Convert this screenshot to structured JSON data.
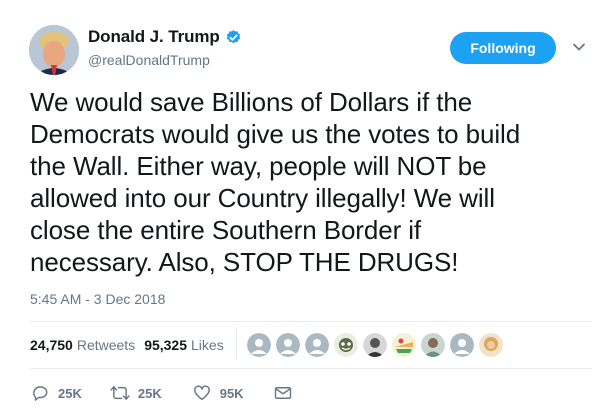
{
  "author": {
    "display_name": "Donald J. Trump",
    "handle": "@realDonaldTrump",
    "verified": true
  },
  "follow_button": {
    "label": "Following"
  },
  "tweet": {
    "lines": [
      "We would save Billions of Dollars if the",
      "Democrats would give us the votes to build",
      "the Wall. Either way, people will NOT be",
      "allowed into our Country illegally! We will",
      "close the entire Southern Border if",
      "necessary. Also, STOP THE DRUGS!"
    ],
    "timestamp": "5:45 AM - 3 Dec 2018"
  },
  "stats": {
    "retweets": {
      "count": "24,750",
      "label": "Retweets"
    },
    "likes": {
      "count": "95,325",
      "label": "Likes"
    }
  },
  "likers": [
    {
      "icon": "default-avatar",
      "color": "#aab8c2"
    },
    {
      "icon": "default-avatar",
      "color": "#aab8c2"
    },
    {
      "icon": "default-avatar",
      "color": "#aab8c2"
    },
    {
      "icon": "cartoon-avatar",
      "color": "#5d6b4a"
    },
    {
      "icon": "photo-avatar",
      "color": "#555555"
    },
    {
      "icon": "colorful-avatar",
      "color": "#e8b34a"
    },
    {
      "icon": "photo-avatar",
      "color": "#6b8f8a"
    },
    {
      "icon": "default-avatar",
      "color": "#aab8c2"
    },
    {
      "icon": "photo-avatar",
      "color": "#d9a860"
    }
  ],
  "actions": {
    "reply": {
      "icon": "reply-icon",
      "count": "25K"
    },
    "retweet": {
      "icon": "retweet-icon",
      "count": "25K"
    },
    "like": {
      "icon": "heart-icon",
      "count": "95K"
    },
    "message": {
      "icon": "envelope-icon"
    }
  },
  "colors": {
    "accent": "#1da1f2",
    "text": "#14171a",
    "muted": "#657786",
    "border": "#e6ecf0"
  }
}
